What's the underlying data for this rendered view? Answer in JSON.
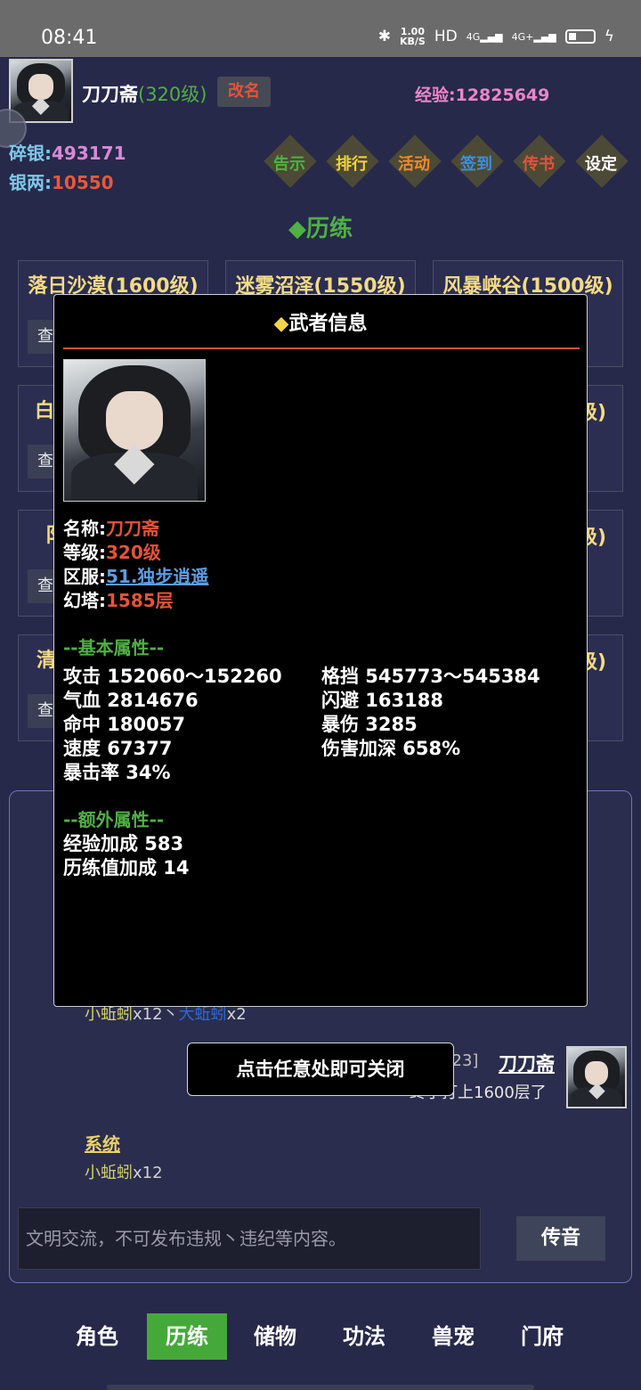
{
  "status": {
    "time": "08:41",
    "speed_value": "1.00",
    "speed_unit": "KB/S",
    "hd": "HD",
    "sim1": "4G",
    "sim2": "4G+"
  },
  "header": {
    "name": "刀刀斋",
    "level": "(320级)",
    "rename": "改名",
    "exp_label": "经验:",
    "exp_value": "12825649",
    "silver_bits_label": "碎银:",
    "silver_bits_value": "493171",
    "silver_label": "银两:",
    "silver_value": "10550"
  },
  "menu": [
    {
      "label": "告示",
      "color": "#4fb043"
    },
    {
      "label": "排行",
      "color": "#f3d13c"
    },
    {
      "label": "活动",
      "color": "#f08a2c"
    },
    {
      "label": "签到",
      "color": "#3b8fe0"
    },
    {
      "label": "传书",
      "color": "#e5533a"
    },
    {
      "label": "设定",
      "color": "#ffffff"
    }
  ],
  "section_title": "◆历练",
  "areas": [
    {
      "title": "落日沙漠(1600级)",
      "view": "查"
    },
    {
      "title": "迷雾沼泽(1550级)",
      "view": "查"
    },
    {
      "title": "风暴峡谷(1500级)",
      "view": "查"
    },
    {
      "title": "白",
      "view": "查"
    },
    {
      "title": "",
      "view": ""
    },
    {
      "title": "级)",
      "view": ""
    },
    {
      "title": "阝",
      "view": "查"
    },
    {
      "title": "",
      "view": ""
    },
    {
      "title": "级)",
      "view": ""
    },
    {
      "title": "清",
      "view": "查"
    },
    {
      "title": "",
      "view": ""
    },
    {
      "title": "级)",
      "view": ""
    }
  ],
  "chat": {
    "line1_a": "小蚯蚓",
    "line1_b": "x12丶",
    "line1_c": "大蚯蚓",
    "line1_d": "x2",
    "time": "0:23]",
    "user": "刀刀斋",
    "message": "终于打上1600层了",
    "system_label": "系统",
    "system_item": "小蚯蚓",
    "system_count": "x12",
    "input_placeholder": "文明交流，不可发布违规丶违纪等内容。",
    "send": "传音"
  },
  "nav": [
    {
      "label": "角色",
      "active": false
    },
    {
      "label": "历练",
      "active": true
    },
    {
      "label": "储物",
      "active": false
    },
    {
      "label": "功法",
      "active": false
    },
    {
      "label": "兽宠",
      "active": false
    },
    {
      "label": "门府",
      "active": false
    }
  ],
  "toast": "点击任意处即可关闭",
  "modal": {
    "title_diamond": "◆",
    "title": "武者信息",
    "name_label": "名称:",
    "name_value": "刀刀斋",
    "level_label": "等级:",
    "level_value": "320级",
    "server_label": "区服:",
    "server_value": "51.独步逍遥",
    "tower_label": "幻塔:",
    "tower_value": "1585层",
    "basic_head": "--基本属性--",
    "basic_left": [
      "攻击 152060～152260",
      "气血 2814676",
      "命中 180057",
      "速度 67377",
      "暴击率 34%"
    ],
    "basic_right": [
      "格挡 545773～545384",
      "闪避 163188",
      "暴伤 3285",
      "伤害加深 658%"
    ],
    "extra_head": "--额外属性--",
    "extra": [
      "经验加成 583",
      "历练值加成 14"
    ]
  }
}
